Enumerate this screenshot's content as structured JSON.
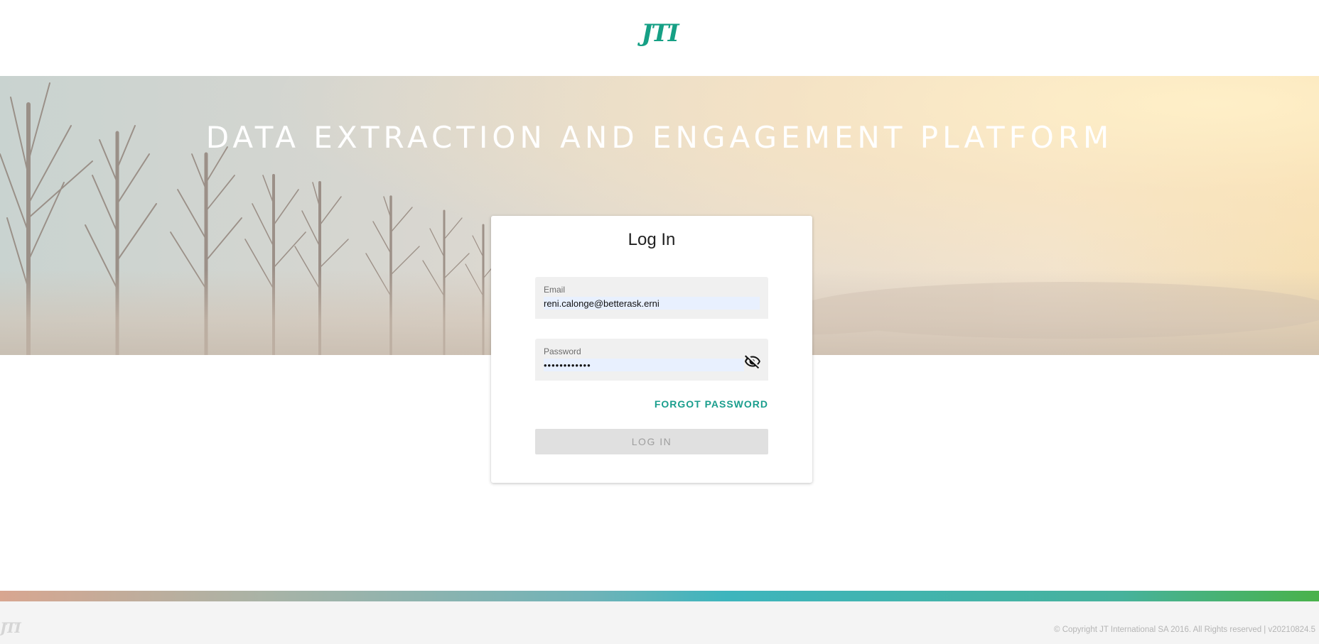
{
  "header": {
    "logo_text": "JTI"
  },
  "hero": {
    "title": "DATA EXTRACTION AND ENGAGEMENT PLATFORM"
  },
  "login": {
    "title": "Log In",
    "email": {
      "label": "Email",
      "value": "reni.calonge@betterask.erni"
    },
    "password": {
      "label": "Password",
      "value": "••••••••••••"
    },
    "toggle_visibility_icon": "eye-off-icon",
    "forgot_password_label": "FORGOT PASSWORD",
    "submit_label": "LOG IN"
  },
  "footer": {
    "logo_text": "JTI",
    "copyright": "© Copyright JT International SA 2016. All Rights reserved | v20210824.5"
  },
  "colors": {
    "accent": "#1a9e8d",
    "logo": "#16a085",
    "button_disabled_bg": "#e0e0e0",
    "autofill_bg": "#e8f0fe"
  }
}
